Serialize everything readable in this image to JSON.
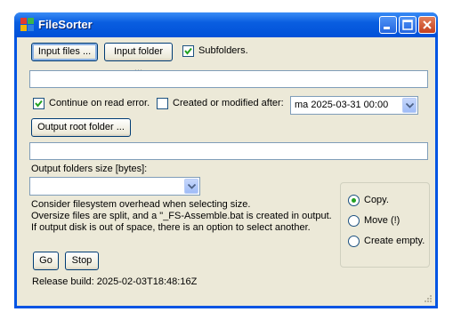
{
  "window": {
    "title": "FileSorter"
  },
  "input": {
    "files_button": "Input files ...",
    "folder_button": "Input folder ...",
    "subfolders_label": "Subfolders.",
    "subfolders_checked": true,
    "path_value": ""
  },
  "options": {
    "continue_label": "Continue on read error.",
    "continue_checked": true,
    "created_label": "Created or modified after:",
    "created_checked": false,
    "date_value": "ma 2025-03-31 00:00"
  },
  "output": {
    "root_button": "Output root folder ...",
    "path_value": "",
    "size_label": "Output folders size [bytes]:",
    "size_value": "",
    "info_line1": "Consider filesystem overhead when selecting size.",
    "info_line2": "Oversize files are split, and a \"_FS-Assemble.bat is created in output.",
    "info_line3": "If output disk is out of space, there is an option to select another."
  },
  "mode": {
    "options": [
      "Copy.",
      "Move (!)",
      "Create empty."
    ],
    "selected": "Copy."
  },
  "actions": {
    "go": "Go",
    "stop": "Stop"
  },
  "status": {
    "build": "Release build: 2025-02-03T18:48:16Z"
  },
  "colors": {
    "title_blue": "#0054e3",
    "face": "#ece9d8",
    "check_green": "#21a121"
  }
}
